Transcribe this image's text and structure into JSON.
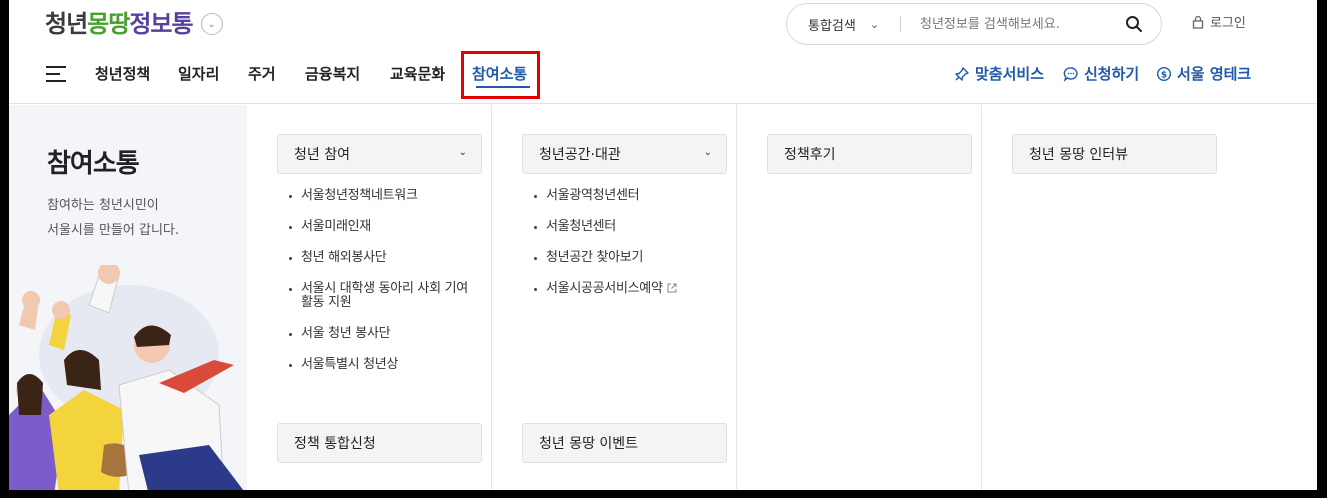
{
  "header": {
    "logo": {
      "part1": "청년",
      "part2": "몽땅",
      "part3": "정보통"
    },
    "search": {
      "scope": "통합검색",
      "placeholder": "청년정보를 검색해보세요."
    },
    "login_label": "로그인"
  },
  "nav": {
    "items": [
      {
        "label": "청년정책"
      },
      {
        "label": "일자리"
      },
      {
        "label": "주거"
      },
      {
        "label": "금융복지"
      },
      {
        "label": "교육문화"
      },
      {
        "label": "참여소통"
      }
    ],
    "utils": [
      {
        "label": "맞춤서비스",
        "icon": "pin-icon"
      },
      {
        "label": "신청하기",
        "icon": "chat-bubble-icon"
      },
      {
        "label": "서울 영테크",
        "icon": "coin-icon"
      }
    ],
    "colors": {
      "active": "#1f5aa8",
      "highlight_box": "#e30000"
    }
  },
  "panel": {
    "title": "참여소통",
    "desc_line1": "참여하는 청년시민이",
    "desc_line2": "서울시를 만들어 갑니다."
  },
  "columns": [
    {
      "category": "청년 참여",
      "items": [
        "서울청년정책네트워크",
        "서울미래인재",
        "청년 해외봉사단",
        "서울시 대학생 동아리 사회 기여",
        "활동 지원",
        "서울 청년 봉사단",
        "서울특별시 청년상"
      ],
      "category2": "정책 통합신청"
    },
    {
      "category": "청년공간·대관",
      "items": [
        "서울광역청년센터",
        "서울청년센터",
        "청년공간 찾아보기",
        "서울시공공서비스예약"
      ],
      "category2": "청년 몽땅 이벤트"
    },
    {
      "category": "정책후기"
    },
    {
      "category": "청년 몽땅 인터뷰"
    }
  ]
}
